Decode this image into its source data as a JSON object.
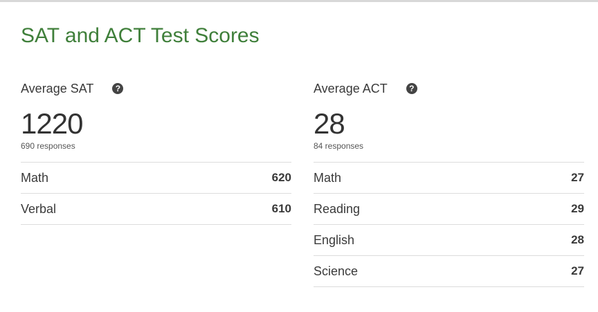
{
  "title": "SAT and ACT Test Scores",
  "sat": {
    "label": "Average SAT",
    "help": "?",
    "score": "1220",
    "responses": "690 responses",
    "rows": [
      {
        "label": "Math",
        "value": "620"
      },
      {
        "label": "Verbal",
        "value": "610"
      }
    ]
  },
  "act": {
    "label": "Average ACT",
    "help": "?",
    "score": "28",
    "responses": "84 responses",
    "rows": [
      {
        "label": "Math",
        "value": "27"
      },
      {
        "label": "Reading",
        "value": "29"
      },
      {
        "label": "English",
        "value": "28"
      },
      {
        "label": "Science",
        "value": "27"
      }
    ]
  }
}
